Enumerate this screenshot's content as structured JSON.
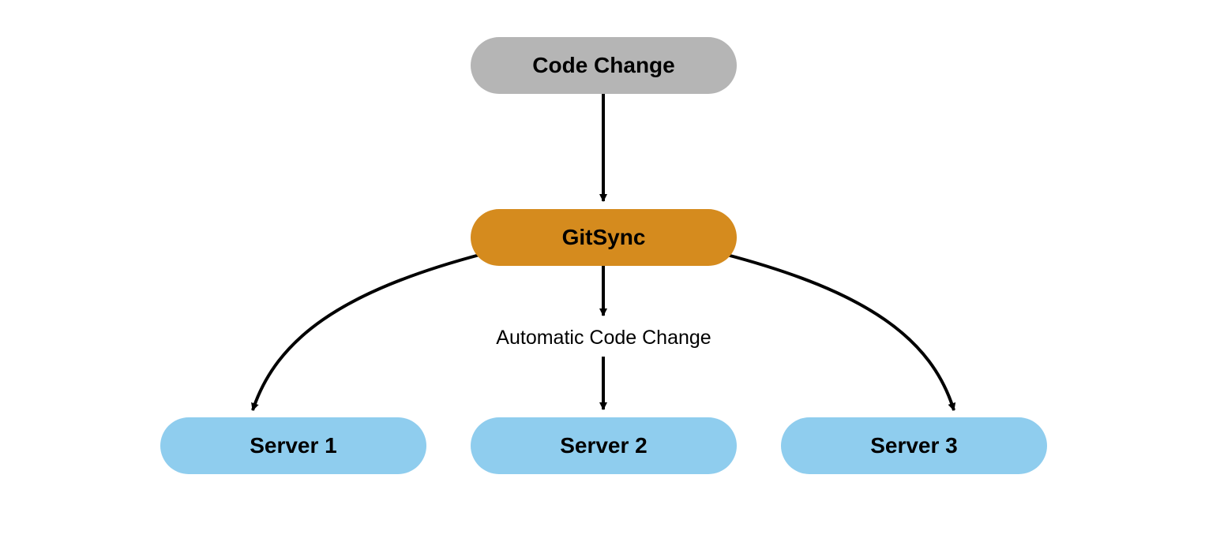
{
  "nodes": {
    "code_change": {
      "label": "Code Change"
    },
    "gitsync": {
      "label": "GitSync"
    },
    "server1": {
      "label": "Server 1"
    },
    "server2": {
      "label": "Server 2"
    },
    "server3": {
      "label": "Server 3"
    }
  },
  "edges": {
    "automatic_label": "Automatic Code Change"
  },
  "colors": {
    "code_change_bg": "#b5b5b5",
    "gitsync_bg": "#d58b1e",
    "server_bg": "#8fcdee",
    "arrow": "#000000"
  }
}
